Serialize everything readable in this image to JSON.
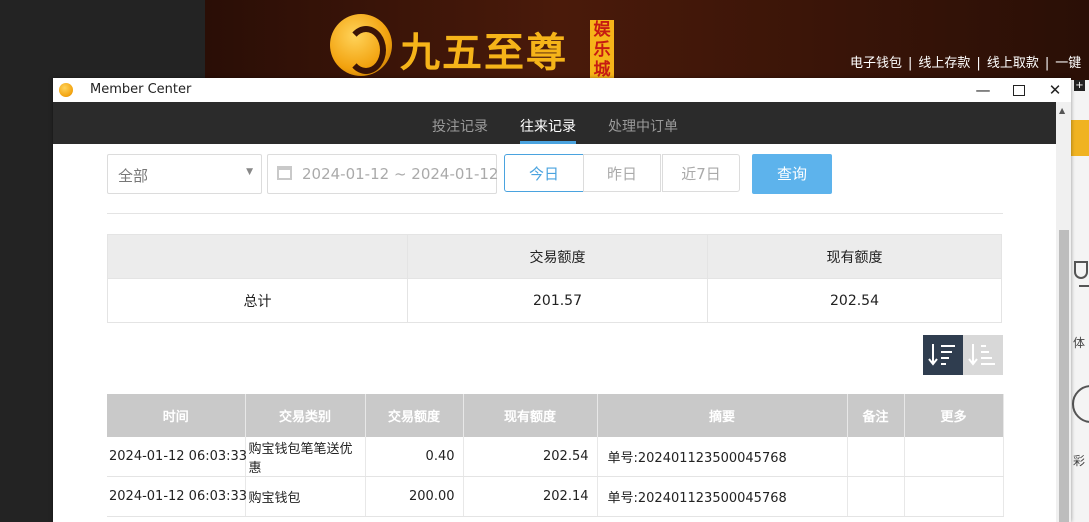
{
  "site": {
    "logo_text": "九五至尊",
    "logo_sub": "娱乐城",
    "top_links": [
      "电子钱包",
      "线上存款",
      "线上取款",
      "一键"
    ],
    "right_text_1": "体",
    "right_text_2": "彩"
  },
  "window": {
    "title": "Member Center"
  },
  "tabs": [
    {
      "label": "投注记录"
    },
    {
      "label": "往来记录"
    },
    {
      "label": "处理中订单"
    }
  ],
  "filters": {
    "type_value": "全部",
    "date_range": "2024-01-12 ~ 2024-01-12",
    "today": "今日",
    "yesterday": "昨日",
    "last7": "近7日",
    "query": "查询"
  },
  "summary": {
    "col_amount": "交易额度",
    "col_balance": "现有额度",
    "row_label": "总计",
    "amount": "201.57",
    "balance": "202.54"
  },
  "table": {
    "headers": [
      "时间",
      "交易类别",
      "交易额度",
      "现有额度",
      "摘要",
      "备注",
      "更多"
    ],
    "rows": [
      {
        "time": "2024-01-12 06:03:33",
        "type": "购宝钱包笔笔送优惠",
        "amount": "0.40",
        "balance": "202.54",
        "memo": "单号:202401123500045768",
        "note": "",
        "more": ""
      },
      {
        "time": "2024-01-12 06:03:33",
        "type": "购宝钱包",
        "amount": "200.00",
        "balance": "202.14",
        "memo": "单号:202401123500045768",
        "note": "",
        "more": ""
      }
    ]
  },
  "colors": {
    "accent": "#4aa3df",
    "query_button": "#5db3ec",
    "tabbar": "#2b2b2b",
    "table_header": "#c9c9c9",
    "logo_gold": "#f6b419"
  },
  "icons": [
    "app-icon",
    "minimize-icon",
    "maximize-icon",
    "close-icon",
    "calendar-icon",
    "dropdown-caret-icon",
    "sort-desc-icon",
    "sort-asc-icon"
  ]
}
